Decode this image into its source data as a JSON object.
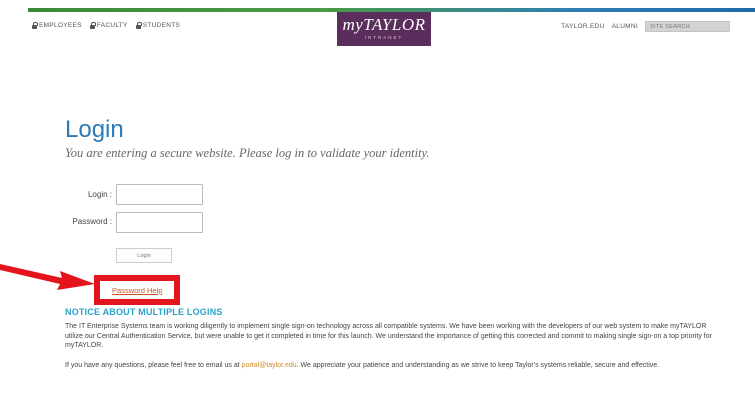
{
  "header": {
    "utility_links": [
      {
        "label": "EMPLOYEES"
      },
      {
        "label": "FACULTY"
      },
      {
        "label": "STUDENTS"
      }
    ],
    "brand": {
      "name": "myTAYLOR",
      "sub": "INTRANET"
    },
    "right_links": [
      {
        "label": "TAYLOR.EDU"
      },
      {
        "label": "ALUMNI"
      }
    ],
    "search_placeholder": "SITE SEARCH"
  },
  "main": {
    "title": "Login",
    "subtitle": "You are entering a secure website. Please log in to validate your identity.",
    "form": {
      "login_label": "Login :",
      "password_label": "Password :",
      "login_value": "",
      "password_value": "",
      "submit_label": "Login"
    },
    "password_help_label": "Password Help",
    "notice": {
      "heading": "NOTICE ABOUT MULTIPLE LOGINS",
      "para1": "The IT Enterprise Systems team is working diligently to implement single sign-on technology across all compatible systems. We have been working with the developers of our web system to make myTAYLOR utilize our Central Authentication Service, but were unable to get it completed in time for this launch. We understand the importance of getting this corrected and commit to making single sign-on a top priority for myTAYLOR.",
      "para2_before": "If you have any questions, please feel free to email us at ",
      "para2_email": "portal@taylor.edu",
      "para2_after": ". We appreciate your patience and understanding as we strive to keep Taylor's systems reliable, secure and effective."
    }
  },
  "colors": {
    "brand_bg": "#5a2d5c",
    "title": "#2a7ab8",
    "notice_heading": "#2aa3c9",
    "annotation_red": "#e3141b",
    "link_orange": "#c8581f"
  }
}
